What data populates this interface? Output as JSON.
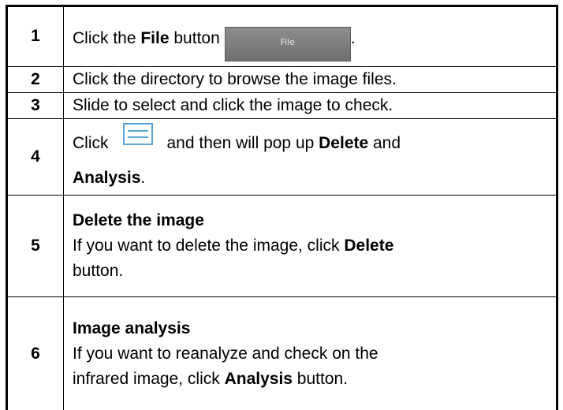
{
  "steps": [
    {
      "num": "1",
      "text_before": "Click the ",
      "bold": "File",
      "text_after": " button",
      "button_label": "File",
      "end": "."
    },
    {
      "num": "2",
      "text": "Click the directory to browse the image files."
    },
    {
      "num": "3",
      "text": "Slide to select and click the image to check."
    },
    {
      "num": "4",
      "text_before": "Click",
      "icon": "menu-icon",
      "text_middle": "and then will pop up ",
      "bold_1": "Delete",
      "text_and": " and",
      "bold_2": "Analysis",
      "end": "."
    },
    {
      "num": "5",
      "heading": "Delete the image",
      "text_before": "If you want to delete the image, click ",
      "bold": "Delete",
      "text_after": "button."
    },
    {
      "num": "6",
      "heading": "Image analysis",
      "line_1": "If you want to reanalyze and check on the",
      "text_before": "infrared image, click ",
      "bold": "Analysis",
      "text_after": " button."
    }
  ]
}
